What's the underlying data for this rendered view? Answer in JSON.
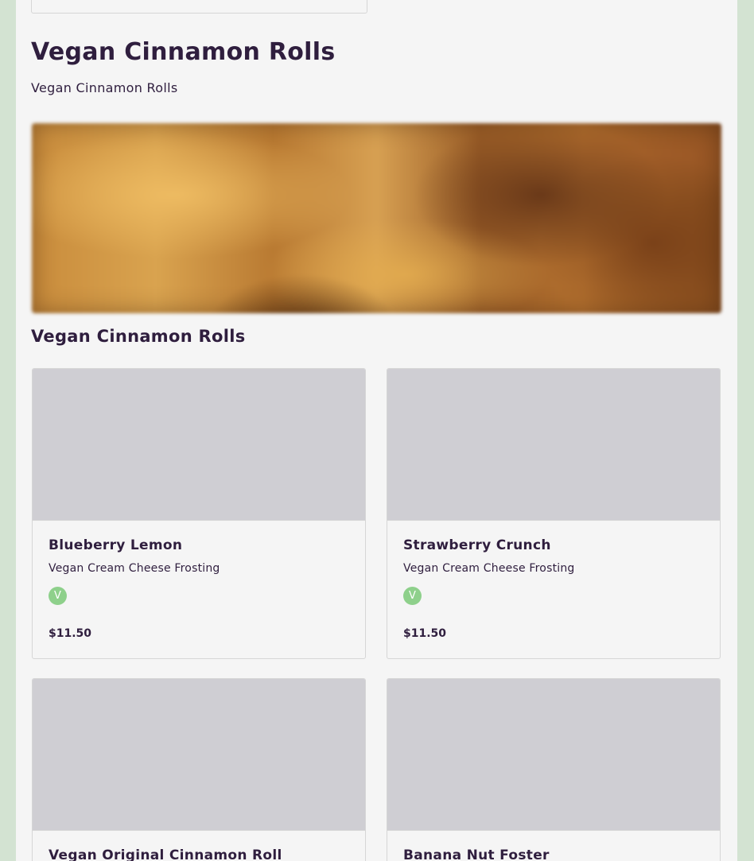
{
  "section": {
    "title": "Vegan Cinnamon Rolls",
    "subtitle": "Vegan Cinnamon Rolls"
  },
  "category": {
    "heading": "Vegan Cinnamon Rolls"
  },
  "items": [
    {
      "name": "Blueberry Lemon",
      "description": "Vegan Cream Cheese Frosting",
      "badge": "V",
      "price": "$11.50"
    },
    {
      "name": "Strawberry Crunch",
      "description": "Vegan Cream Cheese Frosting",
      "badge": "V",
      "price": "$11.50"
    },
    {
      "name": "Vegan Original Cinnamon Roll"
    },
    {
      "name": "Banana Nut Foster"
    }
  ],
  "colors": {
    "background": "#d3e3d2",
    "page": "#f5f5f5",
    "text": "#2f1e3e",
    "image_placeholder": "#cfced3",
    "vegan_badge": "#8ed08b"
  }
}
